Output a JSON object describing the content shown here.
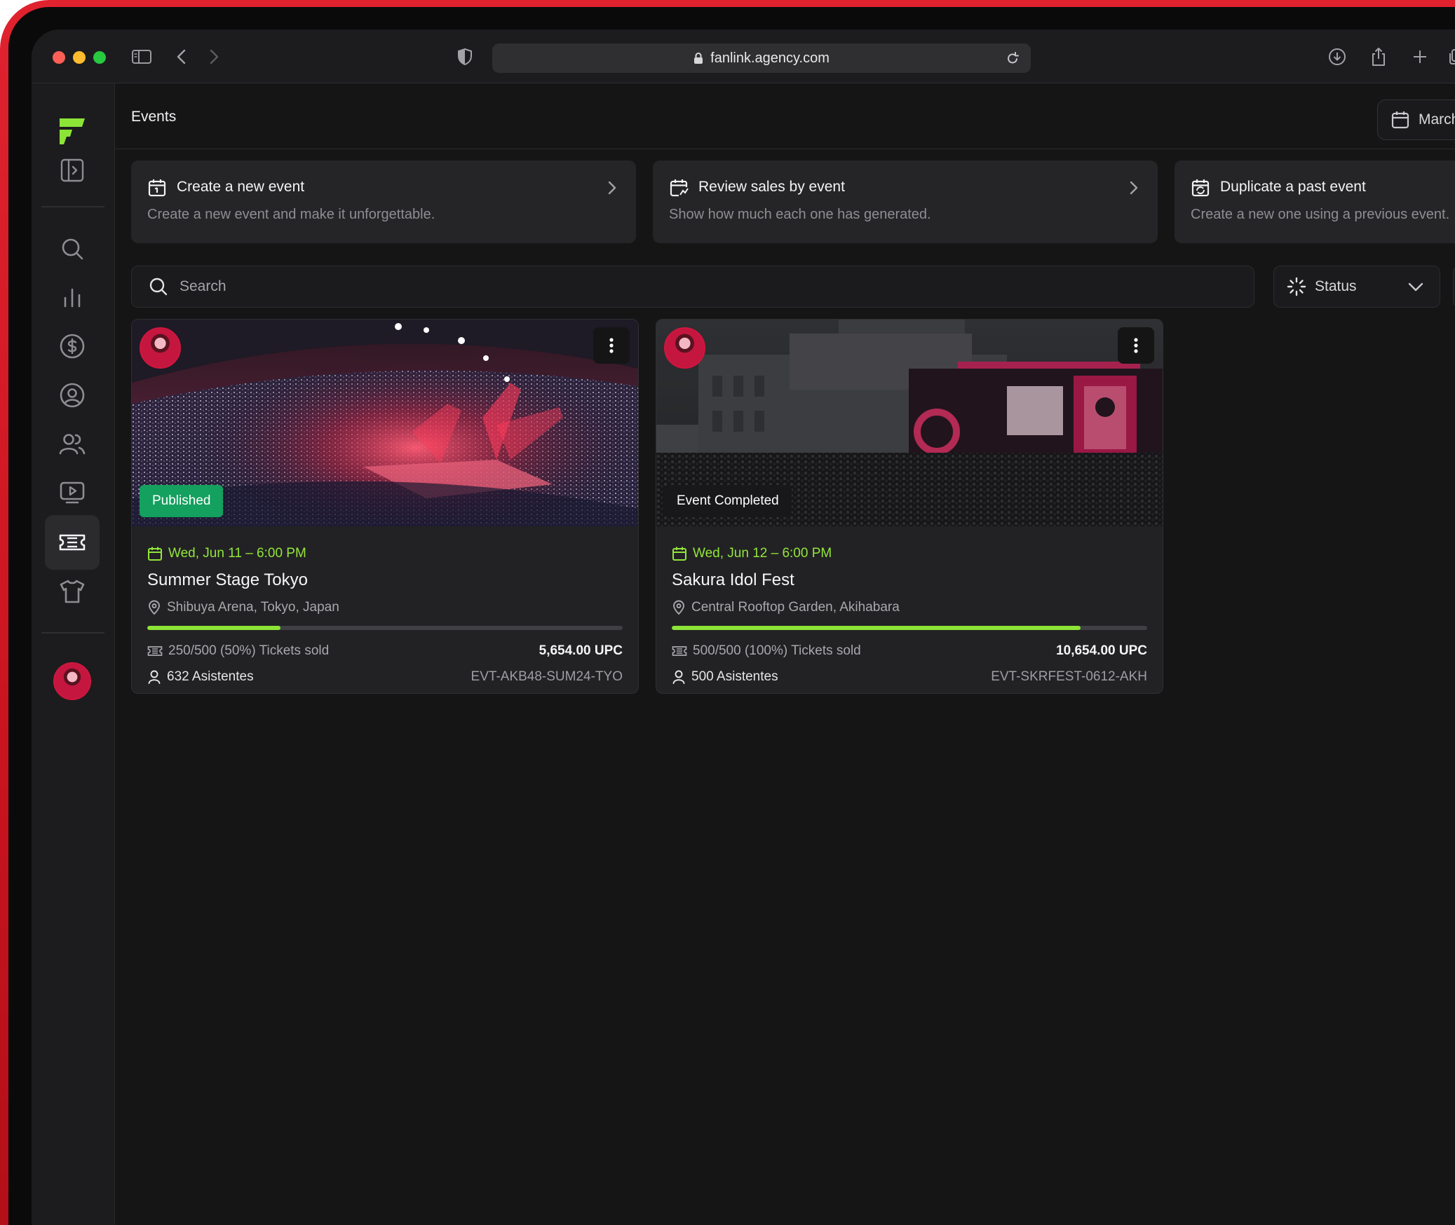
{
  "browser": {
    "url": "fanlink.agency.com"
  },
  "page": {
    "title": "Events",
    "date_picker_label": "March"
  },
  "actions": [
    {
      "title": "Create a new event",
      "subtitle": "Create a new event and make it unforgettable.",
      "icon": "calendar-plus-icon"
    },
    {
      "title": "Review sales by event",
      "subtitle": "Show how much each one has generated.",
      "icon": "calendar-chart-icon"
    },
    {
      "title": "Duplicate a past event",
      "subtitle": "Create a new one using a previous event.",
      "icon": "calendar-repeat-icon"
    }
  ],
  "search": {
    "placeholder": "Search"
  },
  "filters": {
    "status_label": "Status"
  },
  "sidebar": {
    "items": [
      "logo",
      "toggle-panel-icon",
      "search-icon",
      "bar-chart-icon",
      "dollar-icon",
      "user-circle-icon",
      "users-icon",
      "video-icon",
      "ticket-icon",
      "tshirt-icon"
    ],
    "active": "ticket-icon"
  },
  "events": [
    {
      "badge": "Published",
      "date": "Wed, Jun 11 – 6:00 PM",
      "title": "Summer Stage Tokyo",
      "location": "Shibuya Arena, Tokyo, Japan",
      "progress": 0.28,
      "tickets": "250/500 (50%) Tickets sold",
      "revenue": "5,654.00 UPC",
      "attendees": "632 Asistentes",
      "code": "EVT-AKB48-SUM24-TYO"
    },
    {
      "badge": "Event Completed",
      "date": "Wed, Jun 12 – 6:00 PM",
      "title": "Sakura Idol Fest",
      "location": "Central Rooftop Garden, Akihabara",
      "progress": 0.86,
      "tickets": "500/500 (100%) Tickets sold",
      "revenue": "10,654.00 UPC",
      "attendees": "500 Asistentes",
      "code": "EVT-SKRFEST-0612-AKH"
    }
  ],
  "colors": {
    "accent_green": "#8ce437",
    "published_badge": "#14a05f",
    "frame_red": "#d21a25",
    "background": "#151516"
  }
}
